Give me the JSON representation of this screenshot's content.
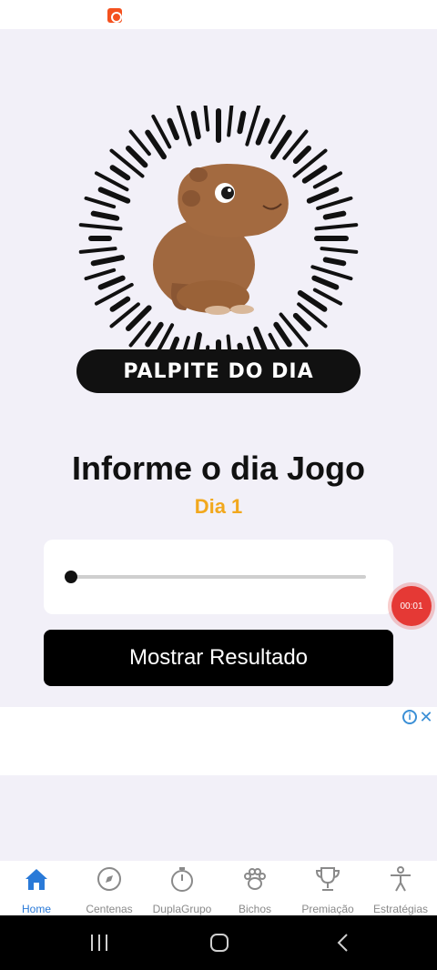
{
  "hero": {
    "banner_text": "PALPITE DO DIA",
    "image": "capybara-illustration"
  },
  "main": {
    "heading": "Informe o dia Jogo",
    "day_label": "Dia 1",
    "slider": {
      "value": 1,
      "min": 1,
      "max": 31
    },
    "show_result_button": "Mostrar Resultado"
  },
  "overlay": {
    "recorder_time": "00:01"
  },
  "ad": {
    "info_icon": "info-icon",
    "close_icon": "close-icon"
  },
  "bottom_nav": {
    "items": [
      {
        "label": "Home",
        "icon": "home-icon",
        "active": true
      },
      {
        "label": "Centenas",
        "icon": "compass-icon",
        "active": false
      },
      {
        "label": "DuplaGrupo",
        "icon": "stopwatch-icon",
        "active": false
      },
      {
        "label": "Bichos",
        "icon": "paw-icon",
        "active": false
      },
      {
        "label": "Premiação",
        "icon": "trophy-icon",
        "active": false
      },
      {
        "label": "Estratégias",
        "icon": "person-icon",
        "active": false
      }
    ]
  },
  "colors": {
    "accent": "#2a7ad8",
    "day_label": "#f2a81d",
    "background": "#f2f0f8"
  }
}
